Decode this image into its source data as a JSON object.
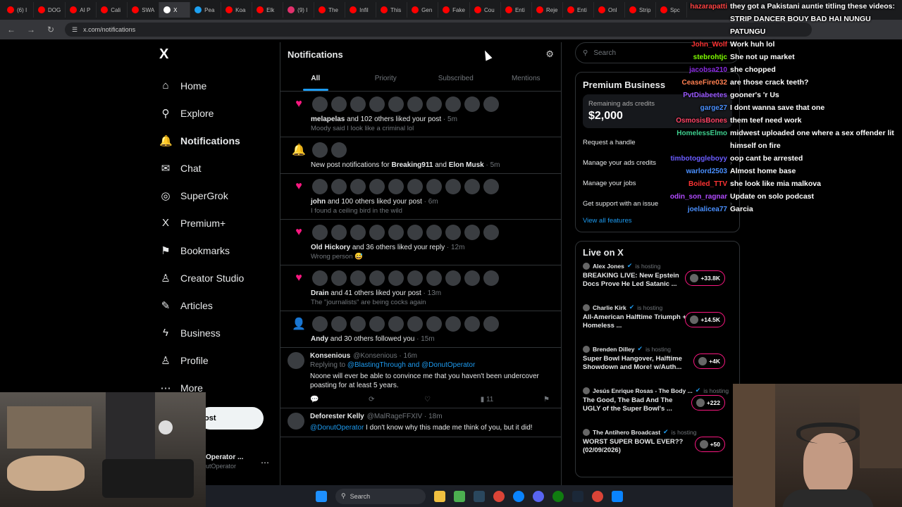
{
  "browser": {
    "tabs": [
      {
        "label": "(6) I",
        "color": "#ff0000"
      },
      {
        "label": "DOG",
        "color": "#ff0000"
      },
      {
        "label": "AI P",
        "color": "#ff0000"
      },
      {
        "label": "Cali",
        "color": "#ff0000"
      },
      {
        "label": "SWA",
        "color": "#ff0000"
      },
      {
        "label": "X",
        "color": "#ffffff"
      },
      {
        "label": "Pea",
        "color": "#1da1f2"
      },
      {
        "label": "Koa",
        "color": "#ff0000"
      },
      {
        "label": "Elk",
        "color": "#ff0000"
      },
      {
        "label": "(9) I",
        "color": "#e1306c"
      },
      {
        "label": "The",
        "color": "#ff0000"
      },
      {
        "label": "Infil",
        "color": "#ff0000"
      },
      {
        "label": "This",
        "color": "#ff0000"
      },
      {
        "label": "Gen",
        "color": "#ff0000"
      },
      {
        "label": "Fake",
        "color": "#ff0000"
      },
      {
        "label": "Cou",
        "color": "#ff0000"
      },
      {
        "label": "Enti",
        "color": "#ff0000"
      },
      {
        "label": "Reje",
        "color": "#ff0000"
      },
      {
        "label": "Enti",
        "color": "#ff0000"
      },
      {
        "label": "Onl",
        "color": "#ff0000"
      },
      {
        "label": "Strip",
        "color": "#ff0000"
      },
      {
        "label": "Spc",
        "color": "#ff0000"
      }
    ],
    "url": "x.com/notifications"
  },
  "nav": {
    "logo": "X",
    "items": [
      {
        "label": "Home",
        "icon": "⌂"
      },
      {
        "label": "Explore",
        "icon": "⚲"
      },
      {
        "label": "Notifications",
        "icon": "🔔"
      },
      {
        "label": "Chat",
        "icon": "✉"
      },
      {
        "label": "SuperGrok",
        "icon": "◎"
      },
      {
        "label": "Premium+",
        "icon": "X"
      },
      {
        "label": "Bookmarks",
        "icon": "⚑"
      },
      {
        "label": "Creator Studio",
        "icon": "♙"
      },
      {
        "label": "Articles",
        "icon": "✎"
      },
      {
        "label": "Business",
        "icon": "ϟ"
      },
      {
        "label": "Profile",
        "icon": "♙"
      },
      {
        "label": "More",
        "icon": "⋯"
      }
    ],
    "post_label": "ost",
    "account_name": "Operator ...",
    "account_handle": "utOperator"
  },
  "feed": {
    "title": "Notifications",
    "tabs": [
      "All",
      "Priority",
      "Subscribed",
      "Mentions"
    ],
    "notifications": [
      {
        "kind": "heart",
        "bold": "melapelas",
        "text": " and 102 others liked your post",
        "time": " · 5m",
        "sub": "Moody said I look like a criminal lol",
        "avatars": 10
      },
      {
        "kind": "bell",
        "pre": "New post notifications for ",
        "bold": "Breaking911",
        "mid": " and ",
        "bold2": "Elon Musk",
        "time": " · 5m",
        "avatars": 2
      },
      {
        "kind": "heart",
        "bold": "john",
        "text": " and 100 others liked your post",
        "time": " · 6m",
        "sub": "I found a ceiling bird in the wild",
        "avatars": 10
      },
      {
        "kind": "heart",
        "bold": "Old Hickory",
        "text": " and 36 others liked your reply",
        "time": " · 12m",
        "sub": "Wrong person 😅",
        "avatars": 10
      },
      {
        "kind": "heart",
        "bold": "Drain",
        "text": " and 41 others liked your post",
        "time": " · 13m",
        "sub": "The \"journalists\" are being cocks again",
        "avatars": 10
      },
      {
        "kind": "person",
        "bold": "Andy",
        "text": " and 30 others followed you",
        "time": " · 15m",
        "avatars": 10
      }
    ],
    "tweets": [
      {
        "name": "Konsenious",
        "handle": "@Konsenious · 16m",
        "reply": "Replying to ",
        "reply_to": "@BlastingThrough and @DonutOperator",
        "text": "Noone will ever be able to convince me that you haven't been undercover poasting for at least 5 years.",
        "views": "11"
      },
      {
        "name": "Deforester Kelly",
        "handle": "@MalRageFFXIV · 18m",
        "mention": "@DonutOperator",
        "text": " I don't know why this made me think of you, but it did!"
      }
    ]
  },
  "right": {
    "search_placeholder": "Search",
    "premium": {
      "title": "Premium Business",
      "credits_label": "Remaining ads credits",
      "credits_amount": "$2,000",
      "rows": [
        "Request a handle",
        "Manage your ads credits",
        "Manage your jobs",
        "Get support with an issue"
      ],
      "link": "View all features"
    },
    "live": {
      "title": "Live on X",
      "items": [
        {
          "host": "Alex Jones",
          "title": "BREAKING LIVE: New Epstein Docs Prove He Led Satanic ...",
          "count": "+33.8K"
        },
        {
          "host": "Charlie Kirk",
          "title": "All-American Halftime Triumph + Homeless ...",
          "count": "+14.5K"
        },
        {
          "host": "Brenden Dilley",
          "title": "Super Bowl Hangover, Halftime Showdown and More! w/Auth...",
          "count": "+4K"
        },
        {
          "host": "Jesús Enrique Rosas - The Body ...",
          "title": "The Good, The Bad And The UGLY of the Super Bowl's ...",
          "count": "+222"
        },
        {
          "host": "The Antihero Broadcast",
          "title": "WORST SUPER BOWL EVER?? (02/09/2026)",
          "count": "+50"
        }
      ],
      "hosting_label": "is hosting"
    }
  },
  "chat": [
    {
      "user": "hazarapatti",
      "color": "#ff4444",
      "text": "they got a Pakistani auntie titling these videos:"
    },
    {
      "user": "",
      "color": "#ffffff",
      "text": "STRIP DANCER BOUY BAD HAI NUNGU"
    },
    {
      "user": "",
      "color": "#ffffff",
      "text": "PATUNGU"
    },
    {
      "user": "John_Wolf",
      "color": "#ff3333",
      "text": "Work huh lol"
    },
    {
      "user": "stebrohtjc",
      "color": "#7fff00",
      "text": "She not up market"
    },
    {
      "user": "jacobsa210",
      "color": "#8a2be2",
      "text": "she chopped"
    },
    {
      "user": "CeaseFire032",
      "color": "#ff7f50",
      "text": "are those crack teeth?"
    },
    {
      "user": "PvtDiabeetes",
      "color": "#9b59ff",
      "text": "gooner's 'r Us"
    },
    {
      "user": "garge27",
      "color": "#4a90ff",
      "text": "I dont wanna save that one"
    },
    {
      "user": "OsmosisBones",
      "color": "#ff4466",
      "text": "them teef need work"
    },
    {
      "user": "HomelessElmo",
      "color": "#3ecf8e",
      "text": "midwest uploaded one where a sex offender lit"
    },
    {
      "user": "",
      "color": "#ffffff",
      "text": "himself on fire"
    },
    {
      "user": "timbotoggleboyy",
      "color": "#6a5cff",
      "text": "oop cant be arrested"
    },
    {
      "user": "warlord2503",
      "color": "#4a90ff",
      "text": "Almost home base"
    },
    {
      "user": "Boiled_TTV",
      "color": "#ff3333",
      "text": "she look like mia malkova"
    },
    {
      "user": "odin_son_ragnar",
      "color": "#b24bff",
      "text": "Update on solo podcast"
    },
    {
      "user": "joelalicea77",
      "color": "#4a90ff",
      "text": "Garcia"
    }
  ],
  "taskbar": {
    "search_label": "Search"
  }
}
